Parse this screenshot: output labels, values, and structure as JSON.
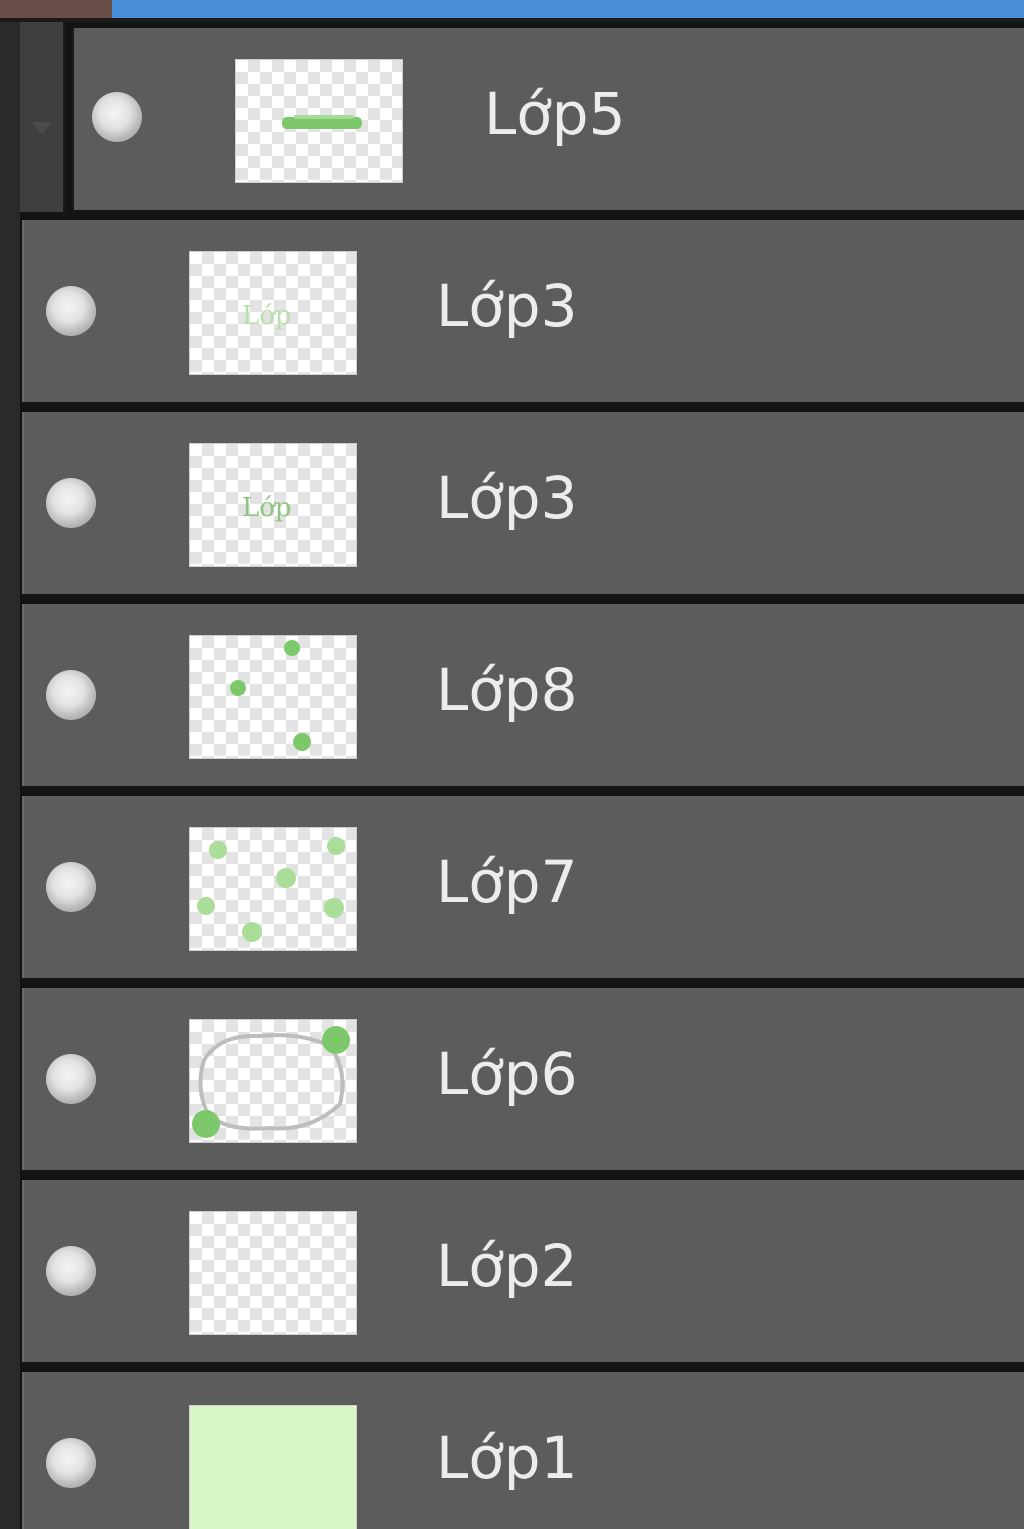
{
  "panel": {
    "accent_color": "#4a90d9",
    "row_color": "#5c5c5c",
    "thumbnail_accent_color": "#7cc86a"
  },
  "layers": [
    {
      "name": "Lớp5",
      "thumbnail": "green-stroke",
      "visible": true,
      "indented": true
    },
    {
      "name": "Lớp3",
      "thumbnail": "green-text",
      "visible": true,
      "indented": false
    },
    {
      "name": "Lớp3",
      "thumbnail": "green-text",
      "visible": true,
      "indented": false
    },
    {
      "name": "Lớp8",
      "thumbnail": "green-dots",
      "visible": true,
      "indented": false
    },
    {
      "name": "Lớp7",
      "thumbnail": "green-scatter",
      "visible": true,
      "indented": false
    },
    {
      "name": "Lớp6",
      "thumbnail": "green-frame",
      "visible": true,
      "indented": false
    },
    {
      "name": "Lớp2",
      "thumbnail": "transparent",
      "visible": true,
      "indented": false
    },
    {
      "name": "Lớp1",
      "thumbnail": "solid-light-green",
      "visible": true,
      "indented": false
    }
  ]
}
